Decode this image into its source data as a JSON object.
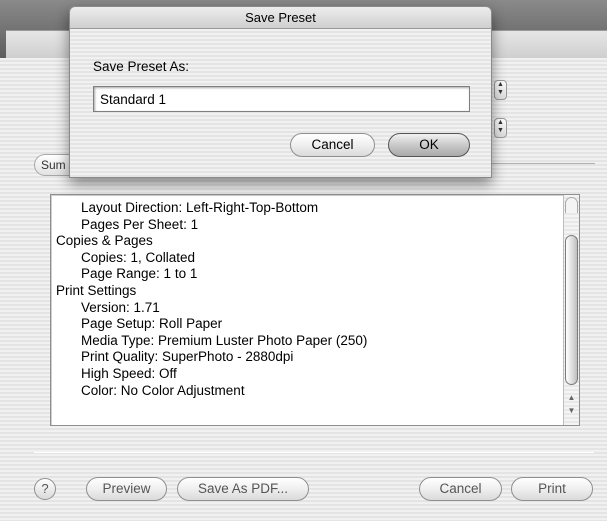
{
  "sheet": {
    "title": "Save Preset",
    "label": "Save Preset As:",
    "input_value": "Standard 1",
    "cancel_label": "Cancel",
    "ok_label": "OK"
  },
  "tab_partial_label": "Sum",
  "summary": {
    "lines": [
      {
        "text": "Layout Direction:  Left-Right-Top-Bottom",
        "indent": true
      },
      {
        "text": "Pages Per Sheet:  1",
        "indent": true
      },
      {
        "text": "Copies & Pages",
        "indent": false
      },
      {
        "text": "Copies:  1, Collated",
        "indent": true
      },
      {
        "text": "Page Range:  1 to 1",
        "indent": true
      },
      {
        "text": "Print Settings",
        "indent": false
      },
      {
        "text": "Version:  1.71",
        "indent": true
      },
      {
        "text": "Page Setup:  Roll Paper",
        "indent": true
      },
      {
        "text": "Media Type:  Premium Luster Photo Paper (250)",
        "indent": true
      },
      {
        "text": "Print Quality:  SuperPhoto - 2880dpi",
        "indent": true
      },
      {
        "text": "High Speed:  Off",
        "indent": true
      },
      {
        "text": "Color:  No Color Adjustment",
        "indent": true
      }
    ]
  },
  "footer": {
    "help_label": "?",
    "preview_label": "Preview",
    "save_pdf_label": "Save As PDF...",
    "cancel_label": "Cancel",
    "print_label": "Print"
  },
  "icons": {
    "stepper": "stepper-updown-icon",
    "help": "question-mark-icon",
    "scroll": "scroll-arrows-icon"
  }
}
